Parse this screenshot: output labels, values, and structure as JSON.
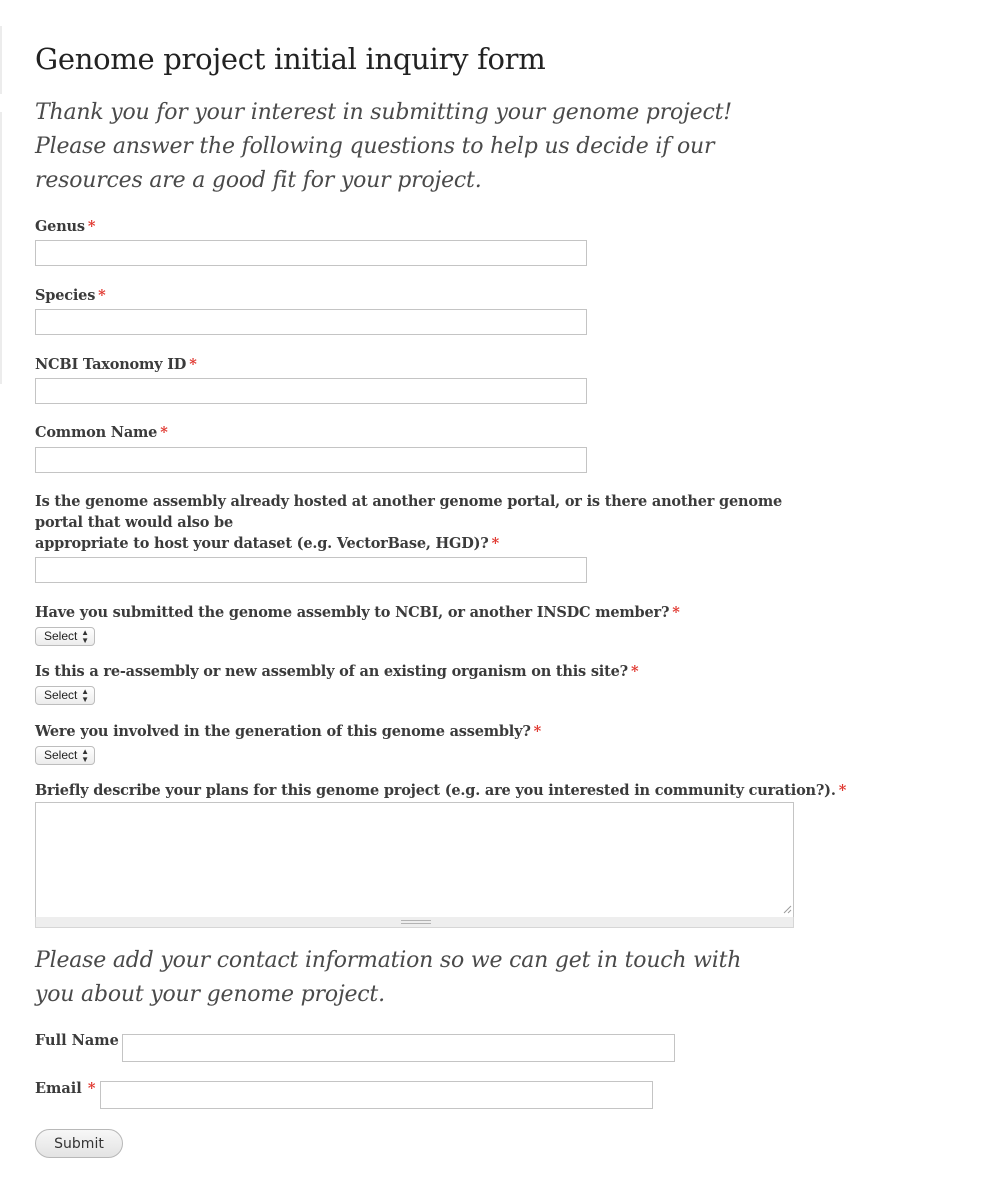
{
  "form": {
    "title": "Genome project initial inquiry form",
    "intro": "Thank you for your interest in submitting your genome project! Please answer the following questions to help us decide if our resources are a good fit for your project.",
    "required_marker": "*",
    "fields": {
      "genus": {
        "label": "Genus",
        "value": ""
      },
      "species": {
        "label": "Species",
        "value": ""
      },
      "ncbi_taxonomy_id": {
        "label": "NCBI Taxonomy ID",
        "value": ""
      },
      "common_name": {
        "label": "Common Name",
        "value": ""
      },
      "other_portal": {
        "label_line1": "Is the genome assembly already hosted at another genome portal, or is there another genome portal that would also be",
        "label_line2": "appropriate to host your dataset (e.g. VectorBase, HGD)?",
        "value": ""
      },
      "submitted_to_ncbi": {
        "label": "Have you submitted the genome assembly to NCBI, or another INSDC member?",
        "selected": "Select"
      },
      "reassembly": {
        "label": "Is this a re-assembly or new assembly of an existing organism on this site?",
        "selected": "Select"
      },
      "involved": {
        "label": "Were you involved in the generation of this genome assembly?",
        "selected": "Select"
      },
      "plans": {
        "label": "Briefly describe your plans for this genome project (e.g. are you interested in community curation?).",
        "value": ""
      }
    },
    "contact_intro": "Please add your contact information so we can get in touch with you about your genome project.",
    "contact": {
      "full_name": {
        "label": "Full Name",
        "value": ""
      },
      "email": {
        "label": "Email",
        "value": ""
      }
    },
    "submit_label": "Submit"
  },
  "colors": {
    "required": "#e0362e",
    "text": "#3b3b3b",
    "border": "#c4c4c4"
  }
}
